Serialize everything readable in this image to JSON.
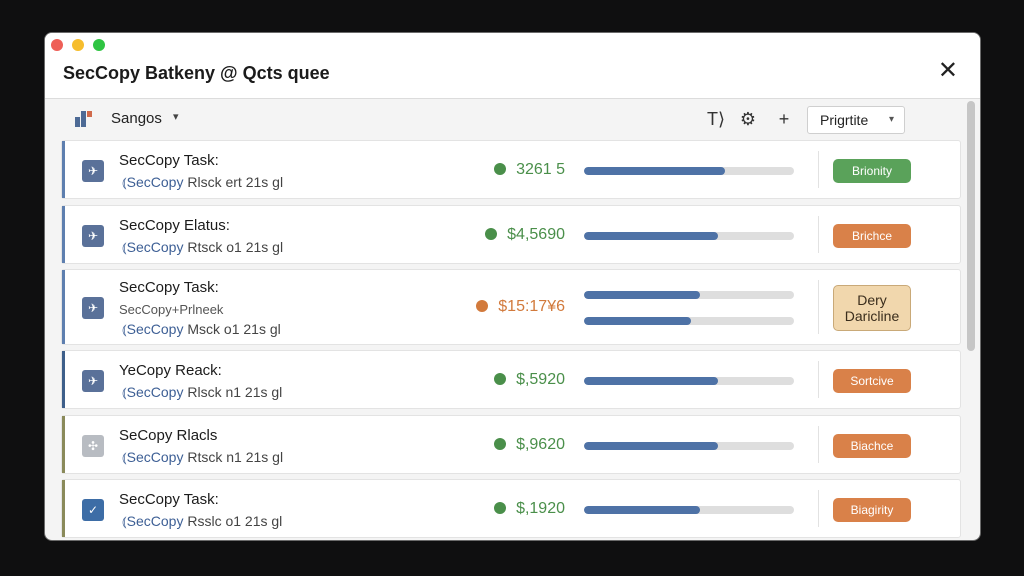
{
  "window": {
    "title": "SecCopy Batkeny @ Qcts quee",
    "close_symbol": "✕"
  },
  "toolbar": {
    "group_label": "Sangos",
    "group_caret": "▾",
    "icons": [
      "text-cursor-icon",
      "settings-icon",
      "add-icon"
    ],
    "add_symbol": "+",
    "text_symbol": "T⟩",
    "settings_symbol": "⚙",
    "priority_label": "Prigrtite",
    "priority_caret": "▾"
  },
  "colors": {
    "accent": "#4e72a6",
    "green": "#4a8f4a",
    "orange": "#d27a3c",
    "badge_green": "#5aa25a",
    "badge_orange": "#d98149",
    "badge_tan": "#f1d7ad"
  },
  "tasks": [
    {
      "title": "SecCopy Task:",
      "sub_hl": "⦅SecCopy",
      "sub_rest": "Rlsck ert 21s gl",
      "amount": "3261 5",
      "amount_color": "#4a8f4a",
      "progress": 0.67,
      "badge": "Brionity",
      "badge_color": "#5aa25a"
    },
    {
      "title": "SecCopy Elatus:",
      "sub_hl": "⦅SecCopy",
      "sub_rest": "Rtsck o1 21s gl",
      "amount": "$4,5690",
      "amount_color": "#4a8f4a",
      "progress": 0.64,
      "badge": "Brichce",
      "badge_color": "#d98149"
    },
    {
      "title": "SecCopy Task:",
      "sub_extra": "SecCopy+Prlneek",
      "sub_hl": "⦅SecCopy",
      "sub_rest": "Msck o1 21s gl",
      "amount": "$15:17¥6",
      "amount_color": "#d27a3c",
      "progress": 0.55,
      "progress2": 0.51,
      "badge_line1": "Dery",
      "badge_line2": "Daricline",
      "badge_color": "#f1d7ad"
    },
    {
      "title": "YeCopy Reack:",
      "sub_hl": "⦅SecCopy",
      "sub_rest": "Rlsck n1 21s gl",
      "amount": "$,5920",
      "amount_color": "#4a8f4a",
      "progress": 0.64,
      "badge": "Sortcive",
      "badge_color": "#d98149"
    },
    {
      "title": "SeCopy Rlacls",
      "sub_hl": "⦅SecCopy",
      "sub_rest": "Rtsck n1 21s gl",
      "amount": "$,9620",
      "amount_color": "#4a8f4a",
      "progress": 0.64,
      "badge": "Biachce",
      "badge_color": "#d98149"
    },
    {
      "title": "SecCopy Task:",
      "sub_hl": "⦅SecCopy",
      "sub_rest": "Rsslc o1 21s gl",
      "amount": "$,1920",
      "amount_color": "#4a8f4a",
      "progress": 0.55,
      "badge": "Biagirity",
      "badge_color": "#d98149"
    }
  ]
}
